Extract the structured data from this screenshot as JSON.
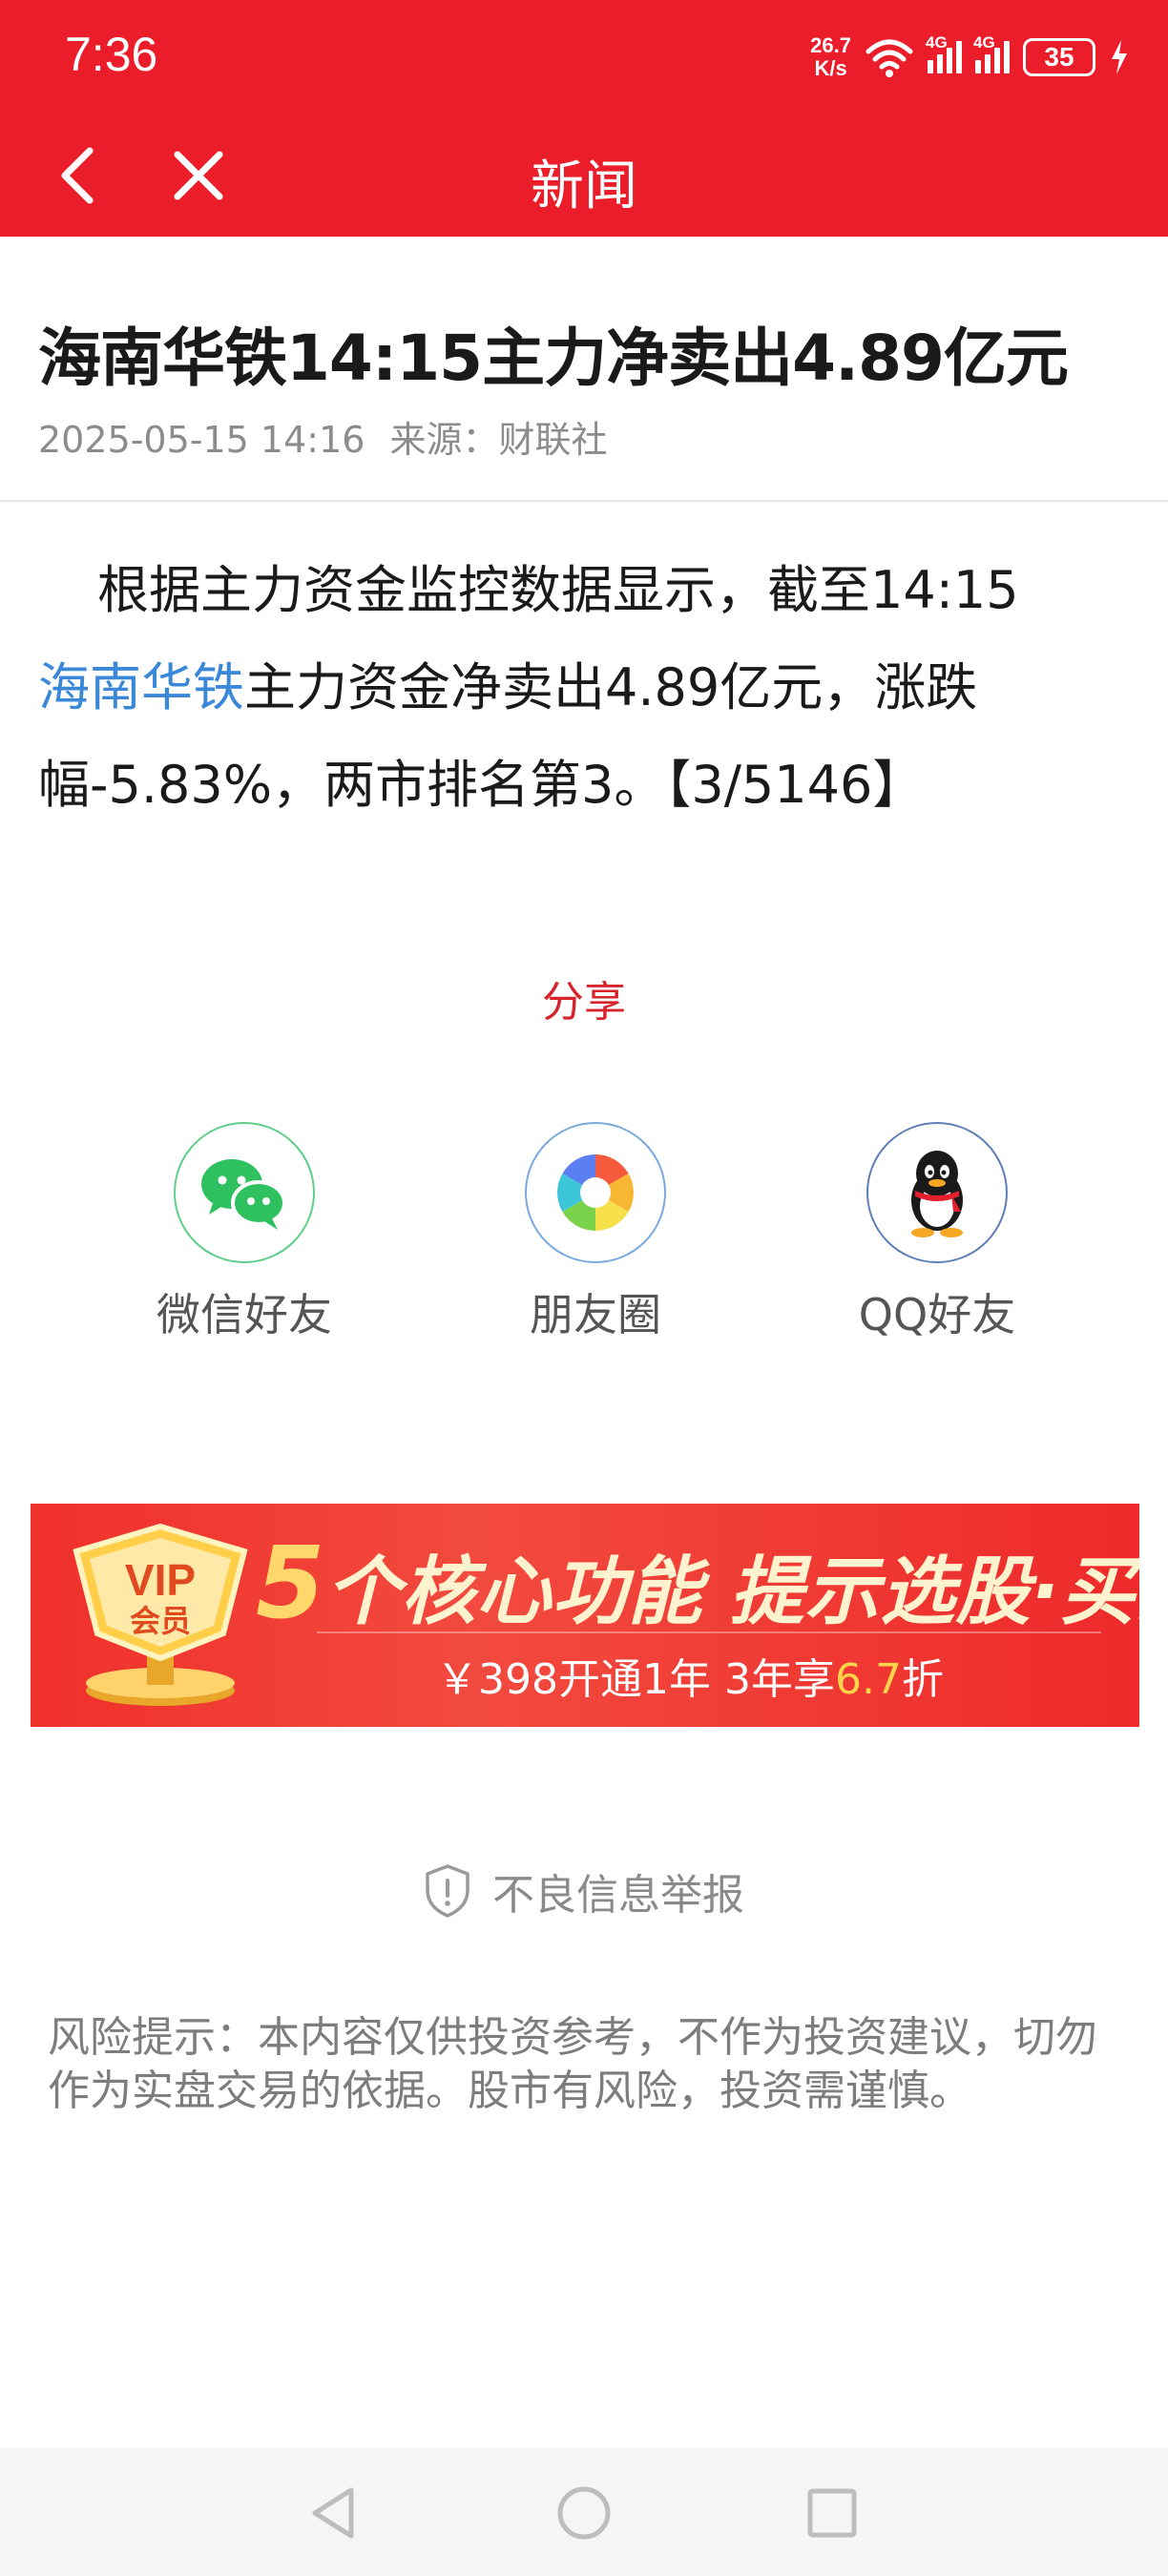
{
  "status_bar": {
    "time": "7:36",
    "net_speed_value": "26.7",
    "net_speed_unit": "K/s",
    "signal_1_label": "4G",
    "signal_2_label": "4G",
    "battery_level": "35"
  },
  "title_bar": {
    "title": "新闻",
    "back_icon": "chevron-left-icon",
    "close_icon": "close-icon"
  },
  "article": {
    "title": "海南华铁14:15主力净卖出4.89亿元",
    "date": "2025-05-15 14:16",
    "source_label": "来源：",
    "source": "财联社",
    "body_before_link": "根据主力资金监控数据显示，截至14:15",
    "stock_link": "海南华铁",
    "body_after_link": "主力资金净卖出4.89亿元，涨跌幅-5.83%，两市排名第3。【3/5146】"
  },
  "share": {
    "title": "分享",
    "items": [
      {
        "label": "微信好友",
        "icon": "wechat-icon"
      },
      {
        "label": "朋友圈",
        "icon": "moments-icon"
      },
      {
        "label": "QQ好友",
        "icon": "qq-icon"
      }
    ]
  },
  "vip_banner": {
    "badge_top": "VIP",
    "badge_bottom": "会员",
    "headline_number": "5",
    "headline_text": "个核心功能 提示选股·买卖",
    "sub_before": "￥398开通1年 3年享",
    "sub_discount": "6.7",
    "sub_after": "折"
  },
  "report": {
    "label": "不良信息举报",
    "icon": "shield-alert-icon"
  },
  "risk_notice": "风险提示：本内容仅供投资参考，不作为投资建议，切勿作为实盘交易的依据。股市有风险，投资需谨慎。",
  "nav_bar": {
    "back_icon": "nav-back-icon",
    "home_icon": "nav-home-icon",
    "recents_icon": "nav-recents-icon"
  },
  "colors": {
    "brand_red": "#ec1d2a",
    "link_blue": "#3b87d8",
    "share_red": "#d6242c"
  }
}
